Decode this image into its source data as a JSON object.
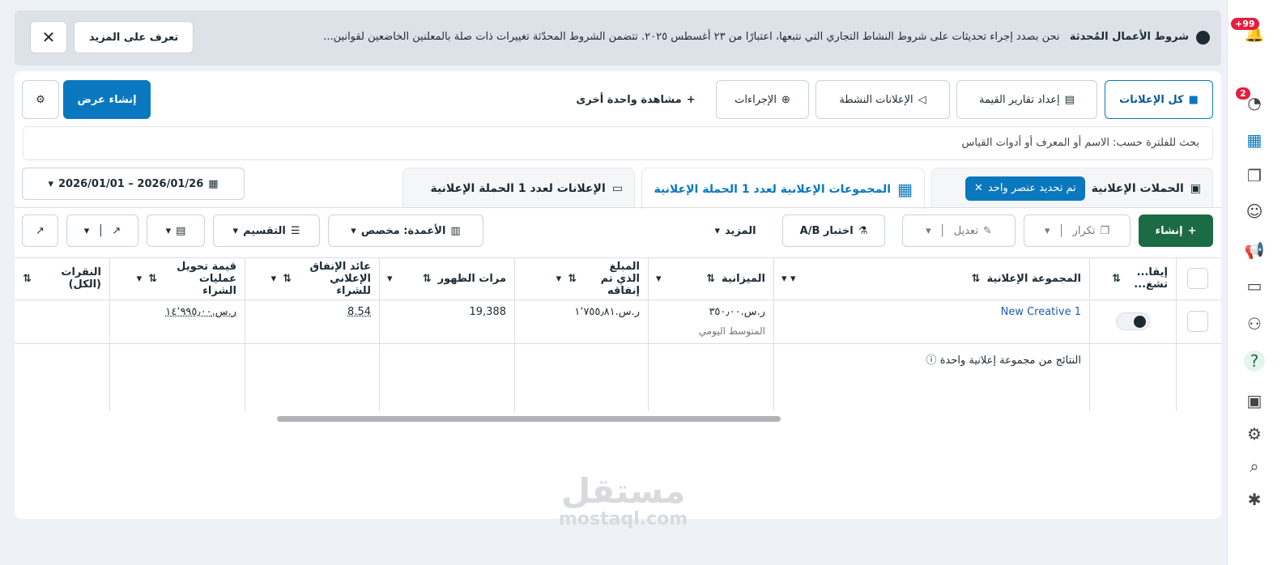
{
  "banner": {
    "title": "شروط الأعمال المُحدثة",
    "text": "نحن بصدد إجراء تحديثات على شروط النشاط التجاري التي نتبعها، اعتبارًا من ٢٣ أغسطس ٢٠٢٥. تتضمن الشروط المحدّثة تغييرات ذات صلة بالمعلنين الخاضعين لقوانين...",
    "learn_more": "تعرف على المزيد"
  },
  "toolbar": {
    "all_ads": "كل الإعلانات",
    "value_reports": "إعداد تقارير القيمة",
    "active_ads": "الإعلانات النشطة",
    "actions": "الإجراءات",
    "more_view": "مشاهدة واحدة أخرى",
    "create_view": "إنشاء عرض"
  },
  "search": {
    "placeholder": "بحث للفلترة حسب: الاسم أو المعرف أو أدوات القياس"
  },
  "tabs": {
    "campaigns": "الحملات الإعلانية",
    "selected": "تم تحديد عنصر واحد",
    "adsets": "المجموعات الإعلانية لعدد 1 الحملة الإعلانية",
    "ads": "الإعلانات لعدد 1 الحملة الإعلانية"
  },
  "date_range": "2026/01/01 – 2026/01/26",
  "actions": {
    "create": "إنشاء",
    "duplicate": "تكرار",
    "edit": "تعديل",
    "ab_test": "اختبار A/B",
    "more": "المزيد",
    "columns": "الأعمدة: مخصص",
    "breakdown": "التقسيم"
  },
  "table": {
    "headers": {
      "toggle": "إيقا... تشغ...",
      "adset": "المجموعة الإعلانية",
      "budget": "الميزانية",
      "spent": "المبلغ الذي تم إنفاقه",
      "impressions": "مرات الظهور",
      "roas": "عائد الإنفاق الإعلاني للشراء",
      "purchase_value": "قيمة تحويل عمليات الشراء",
      "clicks": "النقرات (الكل)"
    },
    "row": {
      "name": "New Creative 1",
      "budget": "ر.س.٣٥٠٫٠٠",
      "budget_sub": "المتوسط اليومي",
      "spent": "ر.س.١٬٧٥٥٫٨١",
      "impressions": "19,388",
      "roas": "8.54",
      "purchase_value": "ر.س.١٤٬٩٩٥٫٠٠"
    },
    "summary": "النتائج من مجموعة إعلانية واحدة"
  },
  "sidebar": {
    "notifications_badge": "+99",
    "alerts_badge": "2"
  },
  "watermark": {
    "text": "مستقل",
    "url": "mostaql.com"
  }
}
